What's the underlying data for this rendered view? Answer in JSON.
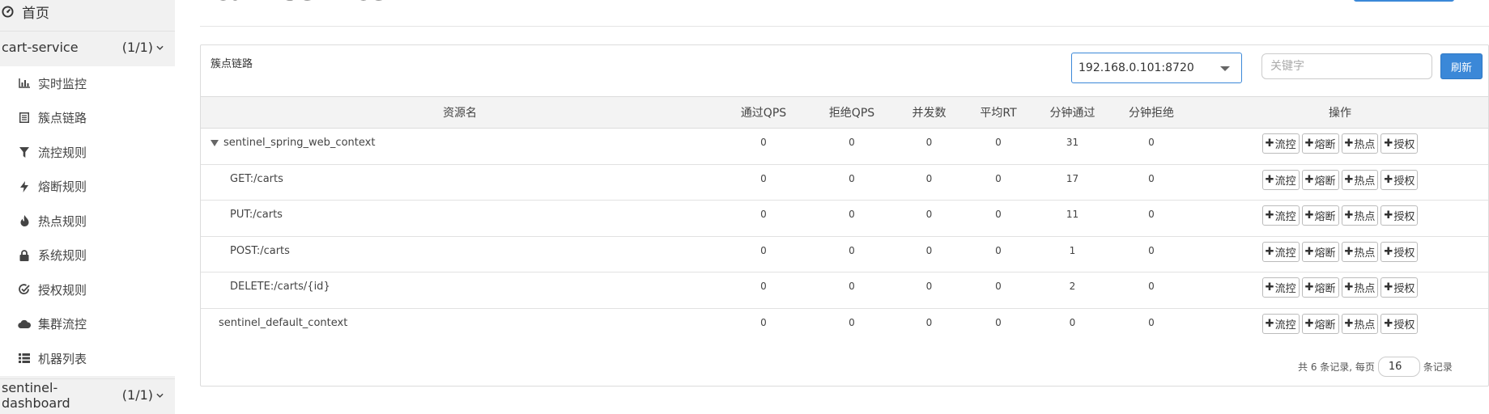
{
  "sidebar": {
    "home": {
      "label": "首页"
    },
    "app": {
      "name": "cart-service",
      "count": "(1/1)"
    },
    "menu": [
      {
        "label": "实时监控",
        "icon": "bar-chart-icon"
      },
      {
        "label": "簇点链路",
        "icon": "list-icon"
      },
      {
        "label": "流控规则",
        "icon": "filter-icon"
      },
      {
        "label": "熔断规则",
        "icon": "flash-icon"
      },
      {
        "label": "热点规则",
        "icon": "fire-icon"
      },
      {
        "label": "系统规则",
        "icon": "lock-icon"
      },
      {
        "label": "授权规则",
        "icon": "check-circle-icon"
      },
      {
        "label": "集群流控",
        "icon": "cloud-icon"
      },
      {
        "label": "机器列表",
        "icon": "list-bullets-icon"
      }
    ],
    "app2": {
      "name": "sentinel-dashboard",
      "count": "(1/1)"
    }
  },
  "header": {
    "title": "cart-service"
  },
  "panel": {
    "title": "簇点链路",
    "machine": "192.168.0.101:8720",
    "search_placeholder": "关键字",
    "refresh_label": "刷新"
  },
  "table": {
    "headers": [
      "资源名",
      "通过QPS",
      "拒绝QPS",
      "并发数",
      "平均RT",
      "分钟通过",
      "分钟拒绝",
      "操作"
    ],
    "rows": [
      {
        "name": "sentinel_spring_web_context",
        "pass_qps": "0",
        "block_qps": "0",
        "threads": "0",
        "rt": "0",
        "minute_pass": "31",
        "minute_block": "0"
      },
      {
        "name": "GET:/carts",
        "pass_qps": "0",
        "block_qps": "0",
        "threads": "0",
        "rt": "0",
        "minute_pass": "17",
        "minute_block": "0"
      },
      {
        "name": "PUT:/carts",
        "pass_qps": "0",
        "block_qps": "0",
        "threads": "0",
        "rt": "0",
        "minute_pass": "11",
        "minute_block": "0"
      },
      {
        "name": "POST:/carts",
        "pass_qps": "0",
        "block_qps": "0",
        "threads": "0",
        "rt": "0",
        "minute_pass": "1",
        "minute_block": "0"
      },
      {
        "name": "DELETE:/carts/{id}",
        "pass_qps": "0",
        "block_qps": "0",
        "threads": "0",
        "rt": "0",
        "minute_pass": "2",
        "minute_block": "0"
      },
      {
        "name": "sentinel_default_context",
        "pass_qps": "0",
        "block_qps": "0",
        "threads": "0",
        "rt": "0",
        "minute_pass": "0",
        "minute_block": "0"
      }
    ],
    "actions": {
      "flow": "流控",
      "degrade": "熔断",
      "hotspot": "热点",
      "auth": "授权"
    }
  },
  "footer": {
    "total_text": "共 6 条记录, 每页",
    "page_size": "16",
    "suffix": "条记录"
  },
  "colors": {
    "accent": "#3b88d8",
    "sidebar_bg": "#f1f1f1"
  }
}
